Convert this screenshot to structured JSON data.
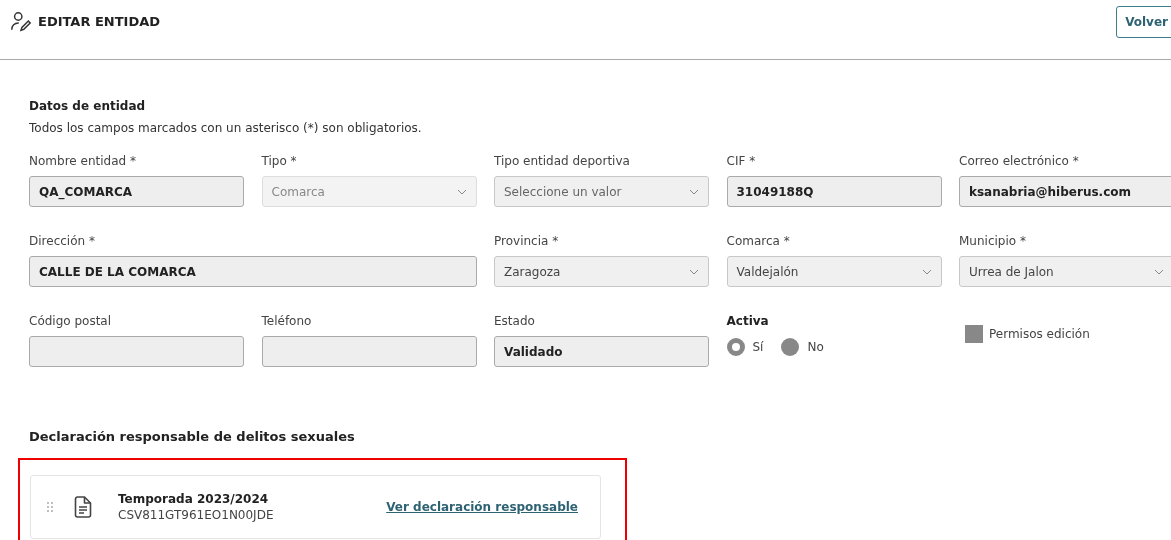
{
  "header": {
    "title": "EDITAR ENTIDAD",
    "back_button": "Volver"
  },
  "section": {
    "title": "Datos de entidad",
    "note": "Todos los campos marcados con un asterisco (*) son obligatorios."
  },
  "fields": [
    {
      "kind": "text",
      "label": "Nombre entidad *",
      "value": "QA_COMARCA"
    },
    {
      "kind": "select",
      "label": "Tipo *",
      "value": "Comarca",
      "disabled": true
    },
    {
      "kind": "select",
      "label": "Tipo entidad deportiva",
      "placeholder": "Seleccione un valor",
      "disabled": false
    },
    {
      "kind": "text",
      "label": "CIF *",
      "value": "31049188Q"
    },
    {
      "kind": "text",
      "label": "Correo electrónico *",
      "value": "ksanabria@hiberus.com"
    },
    {
      "kind": "text",
      "label": "Dirección *",
      "value": "CALLE DE LA COMARCA"
    },
    {
      "kind": "select",
      "label": "Provincia *",
      "value": "Zaragoza",
      "disabled": false
    },
    {
      "kind": "select",
      "label": "Comarca *",
      "value": "Valdejalón",
      "disabled": false
    },
    {
      "kind": "select",
      "label": "Municipio *",
      "value": "Urrea de Jalon",
      "disabled": false
    },
    {
      "kind": "text",
      "label": "Código postal"
    },
    {
      "kind": "text",
      "label": "Teléfono"
    },
    {
      "kind": "text",
      "label": "Estado",
      "value": "Validado"
    },
    {
      "kind": "radio",
      "label": "Activa",
      "options": [
        {
          "label": "Sí",
          "selected": true
        },
        {
          "label": "No",
          "selected": false
        }
      ]
    },
    {
      "kind": "checkbox",
      "label": "Permisos edición",
      "checked": false
    }
  ],
  "declaration": {
    "title": "Declaración responsable de delitos sexuales",
    "items": [
      {
        "season": "Temporada 2023/2024",
        "code": "CSV811GT961EO1N00JDE",
        "link": "Ver declaración responsable"
      }
    ]
  }
}
